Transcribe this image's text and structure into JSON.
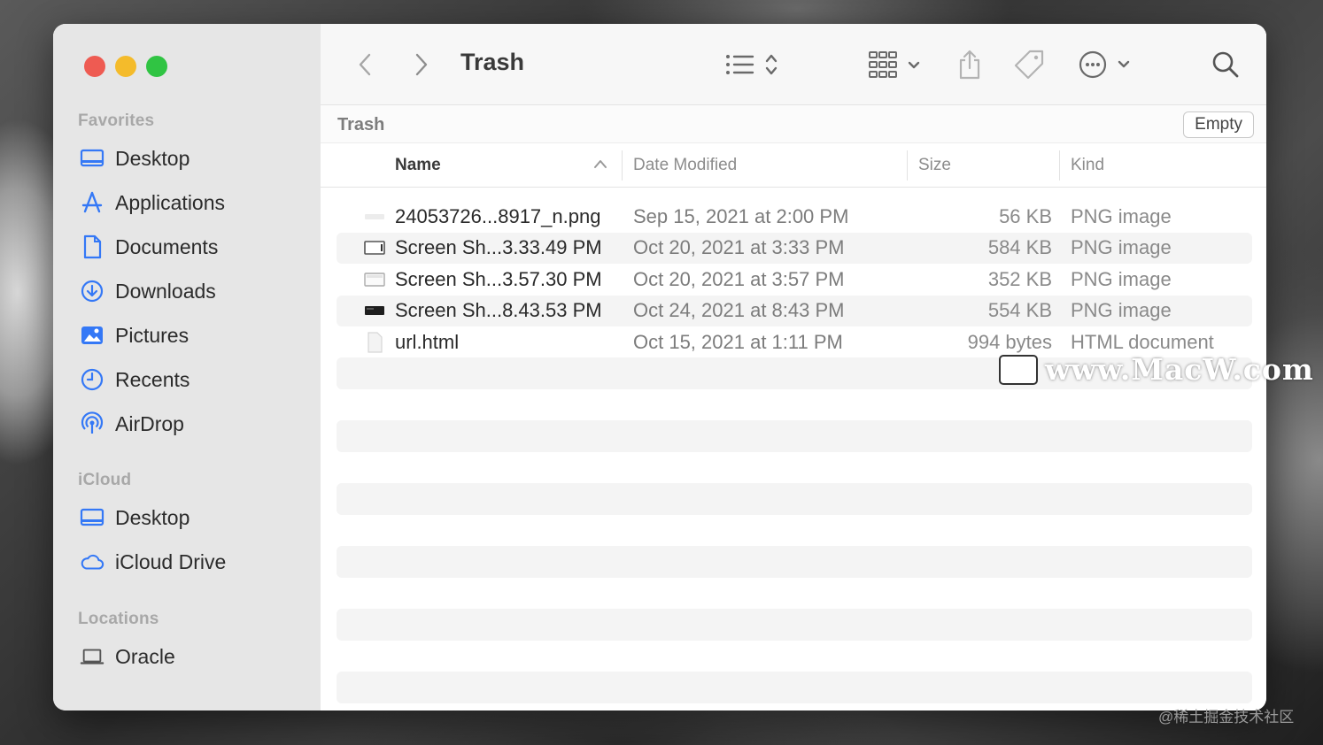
{
  "window": {
    "title": "Trash"
  },
  "sidebar": {
    "favorites_label": "Favorites",
    "favorites": [
      {
        "label": "Desktop",
        "icon": "desktop-icon"
      },
      {
        "label": "Applications",
        "icon": "applications-icon"
      },
      {
        "label": "Documents",
        "icon": "document-icon"
      },
      {
        "label": "Downloads",
        "icon": "download-icon"
      },
      {
        "label": "Pictures",
        "icon": "pictures-icon"
      },
      {
        "label": "Recents",
        "icon": "clock-icon"
      },
      {
        "label": "AirDrop",
        "icon": "airdrop-icon"
      }
    ],
    "icloud_label": "iCloud",
    "icloud": [
      {
        "label": "Desktop",
        "icon": "desktop-icon"
      },
      {
        "label": "iCloud Drive",
        "icon": "cloud-icon"
      }
    ],
    "locations_label": "Locations",
    "locations": [
      {
        "label": "Oracle",
        "icon": "laptop-icon"
      }
    ]
  },
  "toolbar": {
    "title": "Trash",
    "icons": [
      "back-icon",
      "forward-icon",
      "list-view-icon",
      "group-icon",
      "share-icon",
      "tag-icon",
      "more-icon",
      "search-icon"
    ]
  },
  "pathbar": {
    "title": "Trash",
    "empty_label": "Empty"
  },
  "columns": {
    "name": "Name",
    "date": "Date Modified",
    "size": "Size",
    "kind": "Kind"
  },
  "files": [
    {
      "name": "24053726...8917_n.png",
      "date": "Sep 15, 2021 at 2:00 PM",
      "size": "56 KB",
      "kind": "PNG image"
    },
    {
      "name": "Screen Sh...3.33.49 PM",
      "date": "Oct 20, 2021 at 3:33 PM",
      "size": "584 KB",
      "kind": "PNG image"
    },
    {
      "name": "Screen Sh...3.57.30 PM",
      "date": "Oct 20, 2021 at 3:57 PM",
      "size": "352 KB",
      "kind": "PNG image"
    },
    {
      "name": "Screen Sh...8.43.53 PM",
      "date": "Oct 24, 2021 at 8:43 PM",
      "size": "554 KB",
      "kind": "PNG image"
    },
    {
      "name": "url.html",
      "date": "Oct 15, 2021 at 1:11 PM",
      "size": "994 bytes",
      "kind": "HTML document"
    }
  ],
  "watermark": {
    "text": "www.MacW.com"
  },
  "credit": "@稀土掘金技术社区",
  "colors": {
    "accent": "#3478f6",
    "sidebar_bg": "#e6e6e6",
    "red": "#ee5b52",
    "yellow": "#f4bb2b",
    "green": "#30c443"
  }
}
